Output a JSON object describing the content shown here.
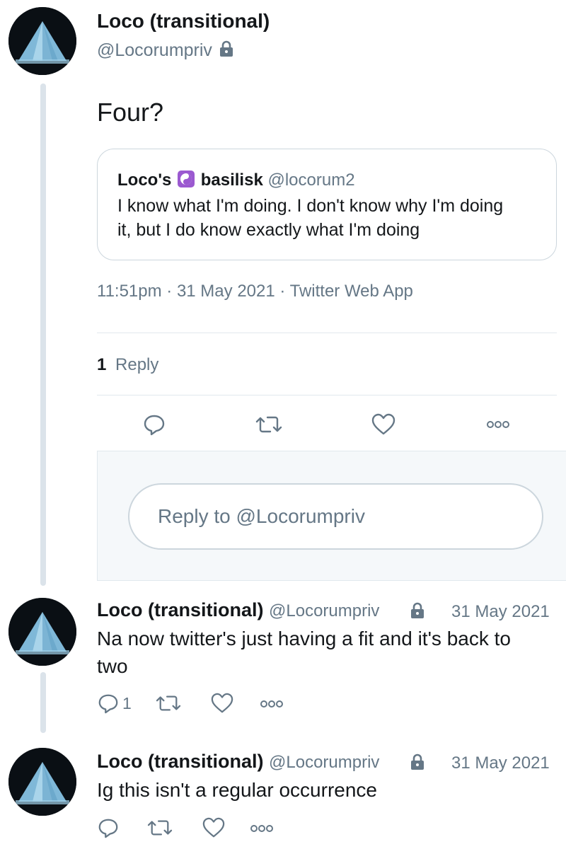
{
  "main_tweet": {
    "author_name": "Loco (transitional)",
    "author_handle": "@Locorumpriv",
    "text": "Four?",
    "timestamp": "11:51pm · 31 May 2021 · Twitter Web App",
    "reply_count": "1",
    "reply_label": "Reply",
    "quoted": {
      "name_prefix": "Loco's",
      "name_suffix": "basilisk",
      "handle": "@locorum2",
      "text_line1": "I know what I'm doing. I don't know why I'm doing",
      "text_line2": "it, but I do know exactly what I'm doing"
    }
  },
  "reply_box": {
    "placeholder": "Reply to @Locorumpriv"
  },
  "replies": [
    {
      "author_name": "Loco (transitional)",
      "author_handle": "@Locorumpriv",
      "date": "31 May 2021",
      "text_line1": "Na now twitter's just having a fit and it's back to",
      "text_line2": "two",
      "reply_count": "1"
    },
    {
      "author_name": "Loco (transitional)",
      "author_handle": "@Locorumpriv",
      "date": "31 May 2021",
      "text_line1": "Ig this isn't a regular occurrence",
      "reply_count": ""
    }
  ],
  "icons": {
    "reply": "reply-icon",
    "retweet": "retweet-icon",
    "like": "heart-icon",
    "more": "more-icon",
    "lock": "lock-icon",
    "yin_yang": "yin-yang-icon"
  },
  "colors": {
    "text": "#14171a",
    "secondary": "#657786",
    "border": "#ccd6dd",
    "thread_line": "#dbe3ea",
    "reply_bg": "#f5f8fa",
    "emoji_purple": "#9b59d0"
  }
}
